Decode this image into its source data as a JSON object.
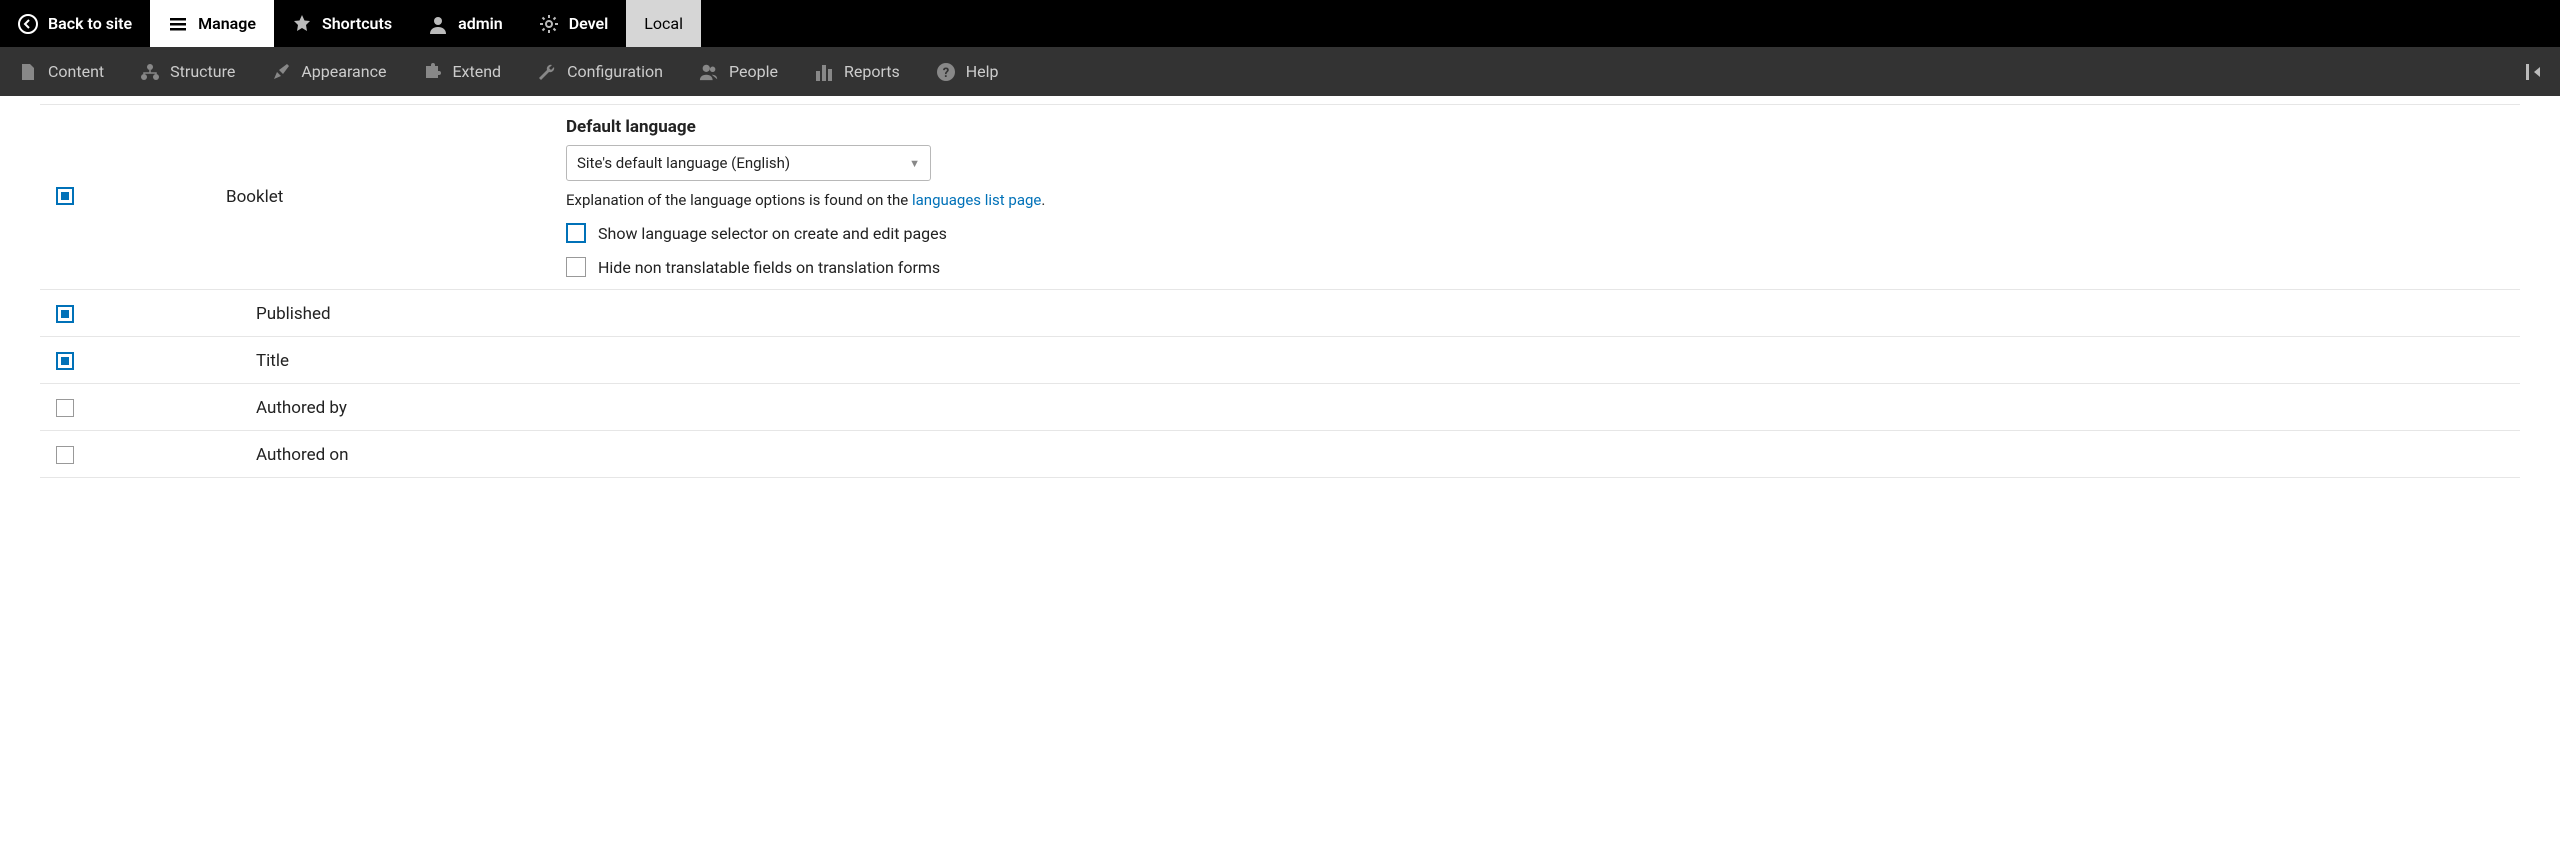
{
  "toolbar_top": {
    "back": "Back to site",
    "manage": "Manage",
    "shortcuts": "Shortcuts",
    "admin": "admin",
    "devel": "Devel",
    "local": "Local"
  },
  "toolbar_admin": {
    "content": "Content",
    "structure": "Structure",
    "appearance": "Appearance",
    "extend": "Extend",
    "configuration": "Configuration",
    "people": "People",
    "reports": "Reports",
    "help": "Help"
  },
  "main_row": {
    "label": "Booklet",
    "default_language_label": "Default language",
    "default_language_value": "Site's default language (English)",
    "explanation_prefix": "Explanation of the language options is found on the ",
    "explanation_link": "languages list page",
    "explanation_suffix": ".",
    "opt_show_selector": "Show language selector on create and edit pages",
    "opt_hide_non_translatable": "Hide non translatable fields on translation forms"
  },
  "rows": [
    {
      "label": "Published",
      "checked": true
    },
    {
      "label": "Title",
      "checked": true
    },
    {
      "label": "Authored by",
      "checked": false
    },
    {
      "label": "Authored on",
      "checked": false
    }
  ]
}
